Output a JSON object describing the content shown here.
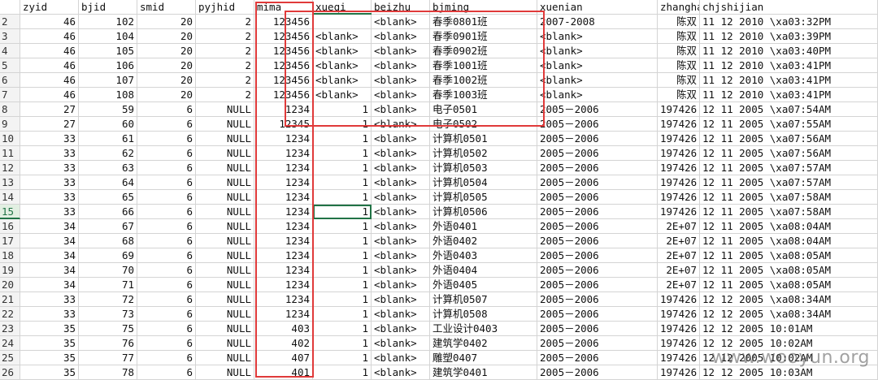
{
  "colors": {
    "grid_line": "#d4d4d4",
    "highlight_box": "#e03a3a",
    "selection": "#217346"
  },
  "columns": [
    "zyid",
    "bjid",
    "smid",
    "pyjhid",
    "mima",
    "xueqi",
    "beizhu",
    "bjming",
    "xuenian",
    "zhanghao",
    "chjshijian"
  ],
  "active_row_number": "15",
  "rows": [
    {
      "n": "2",
      "c": [
        "46",
        "102",
        "20",
        "2",
        "123456",
        "",
        "<blank>",
        "春季0801班",
        "2007-2008",
        "陈双",
        "11 12 2010 \\xa03:32PM"
      ]
    },
    {
      "n": "3",
      "c": [
        "46",
        "104",
        "20",
        "2",
        "123456",
        "<blank>",
        "<blank>",
        "春季0901班",
        "<blank>",
        "陈双",
        "11 12 2010 \\xa03:39PM"
      ]
    },
    {
      "n": "4",
      "c": [
        "46",
        "105",
        "20",
        "2",
        "123456",
        "<blank>",
        "<blank>",
        "春季0902班",
        "<blank>",
        "陈双",
        "11 12 2010 \\xa03:40PM"
      ]
    },
    {
      "n": "5",
      "c": [
        "46",
        "106",
        "20",
        "2",
        "123456",
        "<blank>",
        "<blank>",
        "春季1001班",
        "<blank>",
        "陈双",
        "11 12 2010 \\xa03:41PM"
      ]
    },
    {
      "n": "6",
      "c": [
        "46",
        "107",
        "20",
        "2",
        "123456",
        "<blank>",
        "<blank>",
        "春季1002班",
        "<blank>",
        "陈双",
        "11 12 2010 \\xa03:41PM"
      ]
    },
    {
      "n": "7",
      "c": [
        "46",
        "108",
        "20",
        "2",
        "123456",
        "<blank>",
        "<blank>",
        "春季1003班",
        "<blank>",
        "陈双",
        "11 12 2010 \\xa03:41PM"
      ]
    },
    {
      "n": "8",
      "c": [
        "27",
        "59",
        "6",
        "NULL",
        "1234",
        "1",
        "<blank>",
        "电子0501",
        "2005－2006",
        "197426",
        "12 11 2005 \\xa07:54AM"
      ]
    },
    {
      "n": "9",
      "c": [
        "27",
        "60",
        "6",
        "NULL",
        "12345",
        "1",
        "<blank>",
        "电子0502",
        "2005－2006",
        "197426",
        "12 11 2005 \\xa07:55AM"
      ]
    },
    {
      "n": "10",
      "c": [
        "33",
        "61",
        "6",
        "NULL",
        "1234",
        "1",
        "<blank>",
        "计算机0501",
        "2005－2006",
        "197426",
        "12 11 2005 \\xa07:56AM"
      ]
    },
    {
      "n": "11",
      "c": [
        "33",
        "62",
        "6",
        "NULL",
        "1234",
        "1",
        "<blank>",
        "计算机0502",
        "2005－2006",
        "197426",
        "12 11 2005 \\xa07:56AM"
      ]
    },
    {
      "n": "12",
      "c": [
        "33",
        "63",
        "6",
        "NULL",
        "1234",
        "1",
        "<blank>",
        "计算机0503",
        "2005－2006",
        "197426",
        "12 11 2005 \\xa07:57AM"
      ]
    },
    {
      "n": "13",
      "c": [
        "33",
        "64",
        "6",
        "NULL",
        "1234",
        "1",
        "<blank>",
        "计算机0504",
        "2005－2006",
        "197426",
        "12 11 2005 \\xa07:57AM"
      ]
    },
    {
      "n": "14",
      "c": [
        "33",
        "65",
        "6",
        "NULL",
        "1234",
        "1",
        "<blank>",
        "计算机0505",
        "2005－2006",
        "197426",
        "12 11 2005 \\xa07:58AM"
      ]
    },
    {
      "n": "15",
      "c": [
        "33",
        "66",
        "6",
        "NULL",
        "1234",
        "1",
        "<blank>",
        "计算机0506",
        "2005－2006",
        "197426",
        "12 11 2005 \\xa07:58AM"
      ]
    },
    {
      "n": "16",
      "c": [
        "34",
        "67",
        "6",
        "NULL",
        "1234",
        "1",
        "<blank>",
        "外语0401",
        "2005－2006",
        "2E+07",
        "12 11 2005 \\xa08:04AM"
      ]
    },
    {
      "n": "17",
      "c": [
        "34",
        "68",
        "6",
        "NULL",
        "1234",
        "1",
        "<blank>",
        "外语0402",
        "2005－2006",
        "2E+07",
        "12 11 2005 \\xa08:04AM"
      ]
    },
    {
      "n": "18",
      "c": [
        "34",
        "69",
        "6",
        "NULL",
        "1234",
        "1",
        "<blank>",
        "外语0403",
        "2005－2006",
        "2E+07",
        "12 11 2005 \\xa08:05AM"
      ]
    },
    {
      "n": "19",
      "c": [
        "34",
        "70",
        "6",
        "NULL",
        "1234",
        "1",
        "<blank>",
        "外语0404",
        "2005－2006",
        "2E+07",
        "12 11 2005 \\xa08:05AM"
      ]
    },
    {
      "n": "20",
      "c": [
        "34",
        "71",
        "6",
        "NULL",
        "1234",
        "1",
        "<blank>",
        "外语0405",
        "2005－2006",
        "2E+07",
        "12 11 2005 \\xa08:05AM"
      ]
    },
    {
      "n": "21",
      "c": [
        "33",
        "72",
        "6",
        "NULL",
        "1234",
        "1",
        "<blank>",
        "计算机0507",
        "2005－2006",
        "197426",
        "12 12 2005 \\xa08:34AM"
      ]
    },
    {
      "n": "22",
      "c": [
        "33",
        "73",
        "6",
        "NULL",
        "1234",
        "1",
        "<blank>",
        "计算机0508",
        "2005－2006",
        "197426",
        "12 12 2005 \\xa08:34AM"
      ]
    },
    {
      "n": "23",
      "c": [
        "35",
        "75",
        "6",
        "NULL",
        "403",
        "1",
        "<blank>",
        "工业设计0403",
        "2005－2006",
        "197426",
        "12 12 2005 10:01AM"
      ]
    },
    {
      "n": "24",
      "c": [
        "35",
        "76",
        "6",
        "NULL",
        "402",
        "1",
        "<blank>",
        "建筑学0402",
        "2005－2006",
        "197426",
        "12 12 2005 10:02AM"
      ]
    },
    {
      "n": "25",
      "c": [
        "35",
        "77",
        "6",
        "NULL",
        "407",
        "1",
        "<blank>",
        "雕塑0407",
        "2005－2006",
        "197426",
        "12 12 2005 10:02AM"
      ]
    },
    {
      "n": "26",
      "c": [
        "35",
        "78",
        "6",
        "NULL",
        "401",
        "1",
        "<blank>",
        "建筑学0401",
        "2005－2006",
        "197426",
        "12 12 2005 10:03AM"
      ]
    }
  ],
  "watermark": "www.wooyun.org"
}
